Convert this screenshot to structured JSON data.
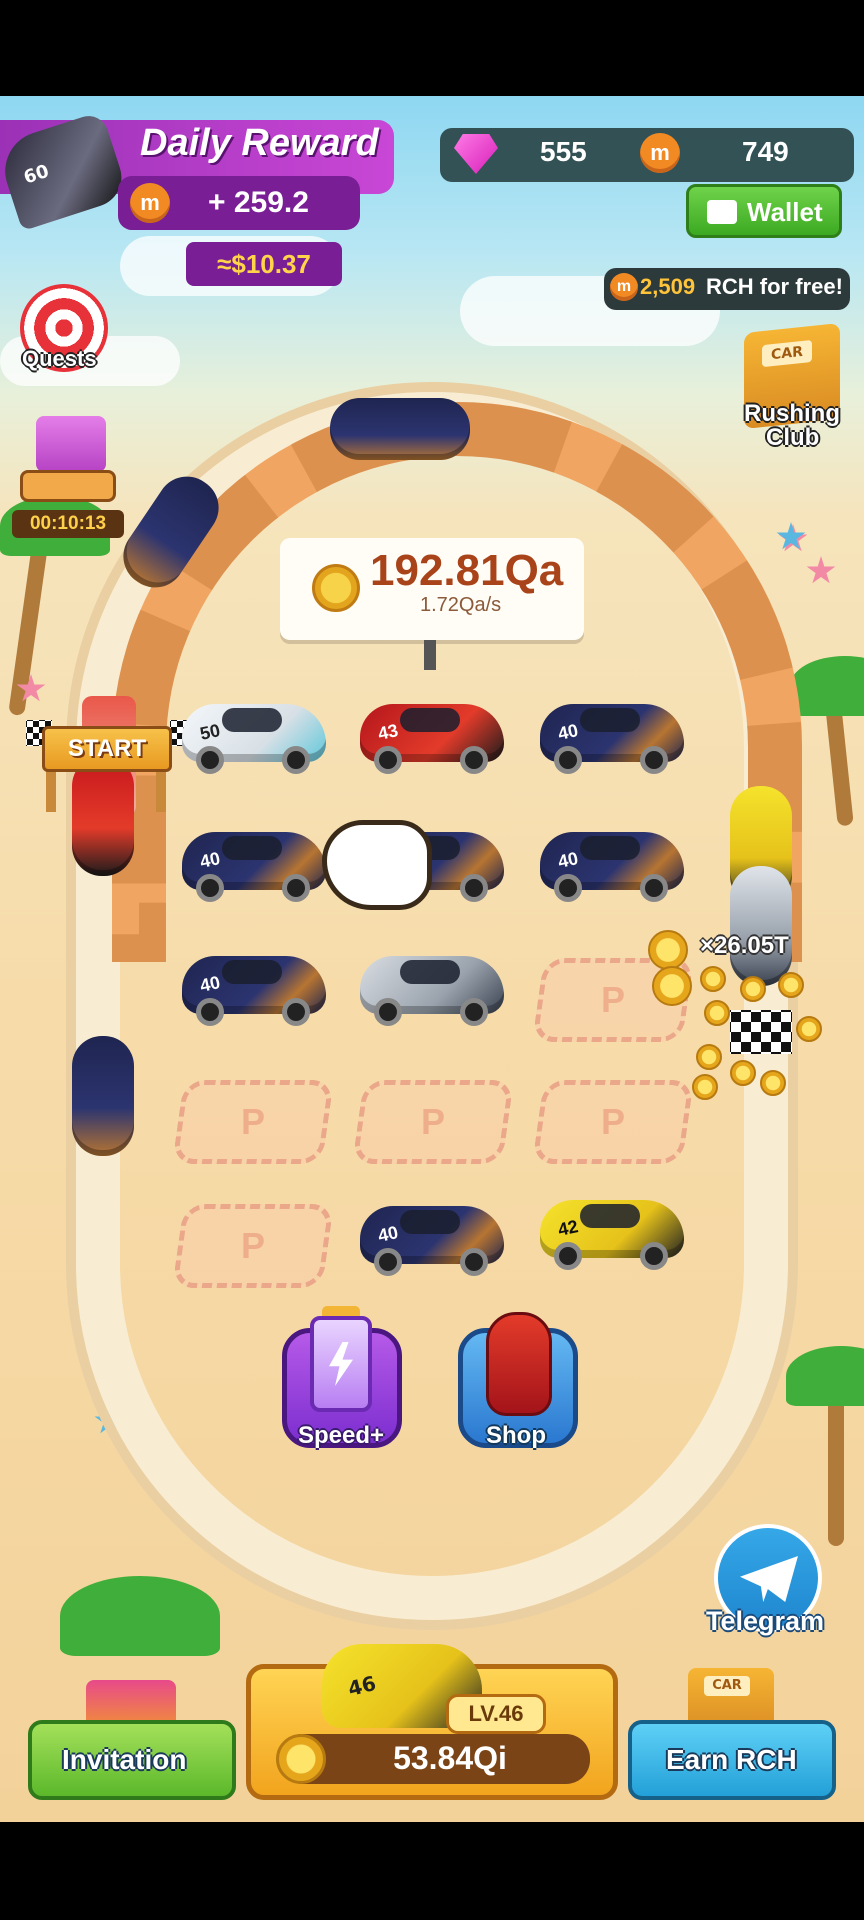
{
  "daily_reward": {
    "title": "Daily Reward",
    "car_number": "60",
    "coin_symbol": "m",
    "amount": "+ 259.2",
    "usd_value": "≈$10.37"
  },
  "resources": {
    "gems": "555",
    "rch": "749",
    "wallet_label": "Wallet",
    "free_offer_amount": "2,509",
    "free_offer_text": "RCH for free!"
  },
  "side": {
    "quests_label": "Quests",
    "rushing_club_line1": "Rushing",
    "rushing_club_line2": "Club",
    "club_sign": "CAR",
    "gift_timer": "00:10:13"
  },
  "balance": {
    "total": "192.81Qa",
    "rate": "1.72Qa/s"
  },
  "track": {
    "start_label": "START",
    "multiplier": "×26.05T"
  },
  "grid": {
    "cars": [
      {
        "num": "50",
        "color": "white"
      },
      {
        "num": "43",
        "color": "red"
      },
      {
        "num": "40",
        "color": "navy"
      },
      {
        "num": "40",
        "color": "navy"
      },
      {
        "num": "40",
        "color": "navy"
      },
      {
        "num": "40",
        "color": "navy"
      },
      {
        "num": "40",
        "color": "navy"
      },
      {
        "num": "",
        "color": "silver"
      },
      {
        "num": "40",
        "color": "navy"
      },
      {
        "num": "42",
        "color": "yellow"
      }
    ],
    "slot_letter": "P"
  },
  "actions": {
    "speed_label": "Speed+",
    "shop_label": "Shop",
    "telegram_label": "Telegram"
  },
  "dock": {
    "invitation_label": "Invitation",
    "buy_car_number": "46",
    "buy_level": "LV.46",
    "buy_price": "53.84Qi",
    "earn_label": "Earn RCH",
    "earn_sign": "CAR"
  },
  "colors": {
    "daily_purple": "#b23dcc",
    "accent_orange": "#f28a24",
    "wallet_green": "#4cbf2c",
    "telegram_blue": "#2a96dc"
  }
}
